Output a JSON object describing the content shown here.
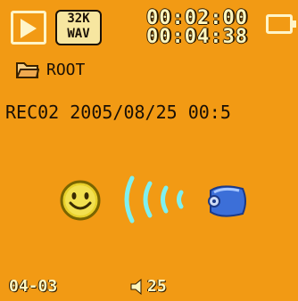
{
  "status_bar": {
    "mode_icon": "play-icon",
    "bitrate_top": "32K",
    "bitrate_bottom": "WAV",
    "elapsed_time": "00:02:00",
    "total_time": "00:04:38",
    "battery_icon": "battery-icon"
  },
  "folder": {
    "icon": "folder-icon",
    "label": "ROOT"
  },
  "recording": {
    "line": "REC02 2005/08/25 00:5"
  },
  "visual": {
    "smiley_icon": "smiley-face-icon",
    "waves_icon": "sound-waves-icon",
    "mic_icon": "microphone-icon"
  },
  "footer": {
    "track": "04-03",
    "volume_icon": "speaker-icon",
    "volume": "25"
  },
  "colors": {
    "background": "#f29a14",
    "accent_text": "#fff7c0",
    "dark_text": "#1a1006",
    "wave": "#7ff0f0"
  }
}
